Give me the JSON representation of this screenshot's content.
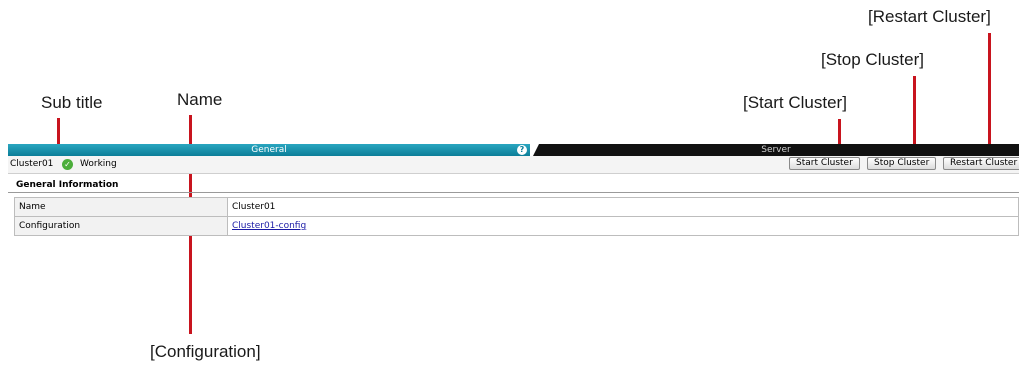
{
  "annotations": {
    "sub_title": "Sub title",
    "name": "Name",
    "start_cluster": "[Start Cluster]",
    "stop_cluster": "[Stop Cluster]",
    "restart_cluster": "[Restart Cluster]",
    "configuration": "[Configuration]"
  },
  "tabs": {
    "general": "General",
    "server": "Server"
  },
  "subtitle": {
    "cluster_name": "Cluster01",
    "status": "Working",
    "status_icon": "check-circle-icon"
  },
  "buttons": {
    "start": "Start Cluster",
    "stop": "Stop Cluster",
    "restart": "Restart Cluster"
  },
  "general_information": {
    "title": "General Information",
    "rows": [
      {
        "label": "Name",
        "value": "Cluster01"
      },
      {
        "label": "Configuration",
        "value": "Cluster01-config"
      }
    ]
  },
  "colors": {
    "annotation": "#c8141e",
    "tab_active": "#0b7d98",
    "tab_inactive": "#111111",
    "status_ok": "#4cae3b",
    "link": "#1a1aa6"
  }
}
